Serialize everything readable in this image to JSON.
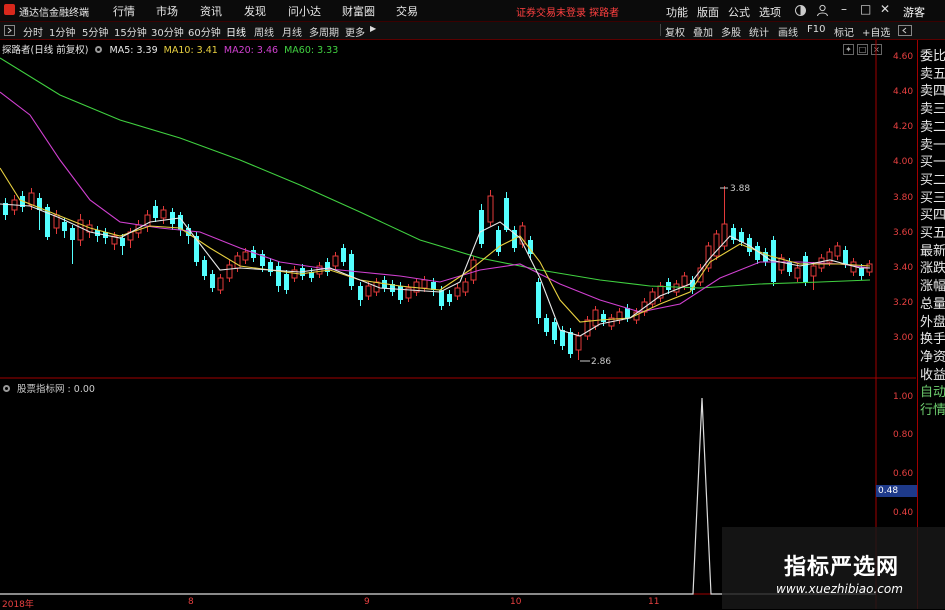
{
  "menubar": {
    "app_name": "通达信金融终端",
    "menus": [
      "行情",
      "市场",
      "资讯",
      "发现",
      "问小达",
      "财富圈",
      "交易"
    ],
    "status": "证券交易未登录  探路者",
    "right_menus": [
      "功能",
      "版面",
      "公式",
      "选项"
    ],
    "window_buttons": [
      "–",
      "□",
      "✕"
    ]
  },
  "toolbar": {
    "periods": [
      "分时",
      "1分钟",
      "5分钟",
      "15分钟",
      "30分钟",
      "60分钟",
      "日线",
      "周线",
      "月线",
      "多周期",
      "更多"
    ],
    "active_period": "日线",
    "right_buttons": [
      "复权",
      "叠加",
      "多股",
      "统计",
      "画线",
      "F10",
      "标记",
      "+自选",
      "游客"
    ]
  },
  "main_chart": {
    "title": "探路者(日线 前复权)",
    "ma_labels": [
      {
        "text": "MA5: 3.39",
        "color": "#e8e8e8"
      },
      {
        "text": "MA10: 3.41",
        "color": "#e8d040"
      },
      {
        "text": "MA20: 3.46",
        "color": "#d040d0"
      },
      {
        "text": "MA60: 3.33",
        "color": "#40d040"
      }
    ],
    "high_annotation": "3.88",
    "low_annotation": "2.86",
    "y_ticks": [
      "4.60",
      "4.40",
      "4.20",
      "4.00",
      "3.80",
      "3.60",
      "3.40",
      "3.20",
      "3.00"
    ]
  },
  "indicator_panel": {
    "label": "股票指标网 : 0.00",
    "y_ticks": [
      "1.00",
      "0.80",
      "0.60",
      "0.40"
    ],
    "marker": "0.48"
  },
  "x_axis": [
    "2018年",
    "8",
    "9",
    "10",
    "11"
  ],
  "right_panel": {
    "items": [
      "委比",
      "卖五",
      "卖四",
      "卖三",
      "卖二",
      "卖一",
      "买一",
      "买二",
      "买三",
      "买四",
      "买五",
      "最新",
      "涨跌",
      "涨幅",
      "总量",
      "外盘",
      "换手",
      "净资",
      "收益"
    ],
    "bottom_items": [
      "自动",
      "行情"
    ]
  },
  "watermark": {
    "title": "指标严选网",
    "url": "www.xuezhibiao.com"
  },
  "colors": {
    "up": "#e23a3a",
    "down": "#54ffff",
    "ma5": "#e8e8e8",
    "ma10": "#e8d040",
    "ma20": "#d040d0",
    "ma60": "#40d040"
  }
}
